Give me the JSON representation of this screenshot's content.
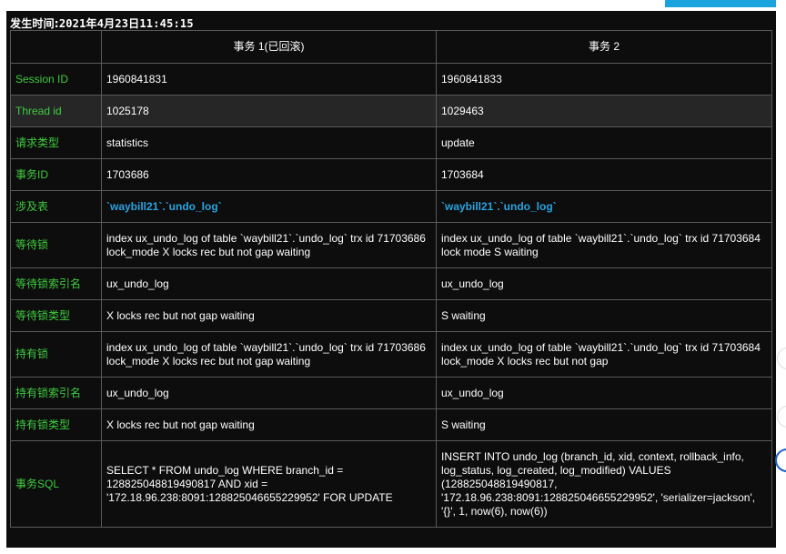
{
  "timestamp": {
    "label": "发生时间:",
    "value": "2021年4月23日11:45:15"
  },
  "headers": [
    "",
    "事务 1(已回滚)",
    "事务 2"
  ],
  "rows": [
    {
      "key": "Session ID",
      "t1": "1960841831",
      "t2": "1960841833"
    },
    {
      "key": "Thread id",
      "t1": "1025178",
      "t2": "1029463"
    },
    {
      "key": "请求类型",
      "t1": "statistics",
      "t2": "update"
    },
    {
      "key": "事务ID",
      "t1": "1703686",
      "t2": "1703684"
    },
    {
      "key": "涉及表",
      "t1": "`waybill21`.`undo_log`",
      "t2": "`waybill21`.`undo_log`"
    },
    {
      "key": "等待锁",
      "t1": "index ux_undo_log of table `waybill21`.`undo_log` trx id 71703686 lock_mode X locks rec but not gap waiting",
      "t2": "index ux_undo_log of table `waybill21`.`undo_log` trx id 71703684 lock mode S waiting"
    },
    {
      "key": "等待锁索引名",
      "t1": "ux_undo_log",
      "t2": "ux_undo_log"
    },
    {
      "key": "等待锁类型",
      "t1": "X locks rec but not gap waiting",
      "t2": "S waiting"
    },
    {
      "key": "持有锁",
      "t1": "index ux_undo_log of table `waybill21`.`undo_log` trx id 71703686 lock_mode X locks rec but not gap waiting",
      "t2": "index ux_undo_log of table `waybill21`.`undo_log` trx id 71703684 lock_mode X locks rec but not gap"
    },
    {
      "key": "持有锁索引名",
      "t1": "ux_undo_log",
      "t2": "ux_undo_log"
    },
    {
      "key": "持有锁类型",
      "t1": "X locks rec but not gap waiting",
      "t2": "S waiting"
    },
    {
      "key": "事务SQL",
      "t1": "SELECT * FROM undo_log WHERE branch_id = 128825048819490817 AND xid = '172.18.96.238:8091:128825046655229952' FOR UPDATE",
      "t2": "INSERT INTO undo_log (branch_id, xid, context, rollback_info, log_status, log_created, log_modified) VALUES (128825048819490817, '172.18.96.238:8091:128825046655229952', 'serializer=jackson', '{}', 1, now(6), now(6))"
    }
  ],
  "colors": {
    "key_text": "#3fcc3f",
    "table_link": "#29a3e0",
    "background": "#0d0d0d",
    "alt_row": "#262626",
    "accent_bar": "#1aa3dc"
  }
}
